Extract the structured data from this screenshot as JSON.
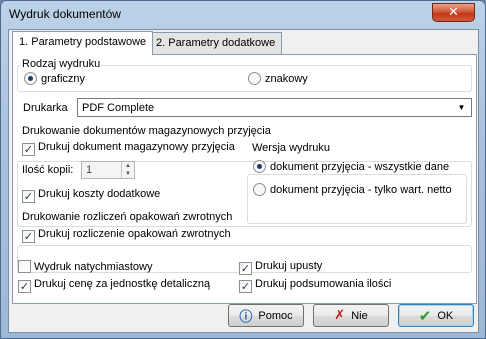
{
  "window": {
    "title": "Wydruk dokumentów",
    "close_symbol": "✕"
  },
  "tabs": [
    {
      "label": "1. Parametry podstawowe",
      "active": true
    },
    {
      "label": "2. Parametry dodatkowe",
      "active": false
    }
  ],
  "rodzaj": {
    "title": "Rodzaj wydruku",
    "options": [
      {
        "label": "graficzny",
        "selected": true
      },
      {
        "label": "znakowy",
        "selected": false
      }
    ]
  },
  "drukarka": {
    "label": "Drukarka",
    "value": "PDF Complete",
    "arrow": "▼"
  },
  "magazynowe": {
    "title": "Drukowanie dokumentów magazynowych przyjęcia",
    "drukuj_label": "Drukuj dokument magazynowy przyjęcia",
    "kopie_label": "Ilość kopii:",
    "kopie_value": "1",
    "koszty_label": "Drukuj koszty dodatkowe",
    "wersja": {
      "title": "Wersja wydruku",
      "options": [
        {
          "label": "dokument przyjęcia - wszystkie dane",
          "selected": true
        },
        {
          "label": "dokument przyjęcia - tylko wart. netto",
          "selected": false
        }
      ]
    }
  },
  "rozliczenia": {
    "title": "Drukowanie rozliczeń opakowań zwrotnych",
    "drukuj_label": "Drukuj rozliczenie opakowań zwrotnych"
  },
  "options": {
    "natychmiastowy": {
      "label": "Wydruk natychmiastowy",
      "checked": false
    },
    "cena": {
      "label": "Drukuj cenę za jednostkę detaliczną",
      "checked": true
    },
    "upusty": {
      "label": "Drukuj upusty",
      "checked": true
    },
    "podsumowania": {
      "label": "Drukuj podsumowania ilości",
      "checked": true
    }
  },
  "buttons": {
    "pomoc": "Pomoc",
    "nie": "Nie",
    "ok": "OK"
  },
  "colors": {
    "accent": "#1e3d6b",
    "ok_green": "#2e9a2e",
    "nie_red": "#c41a1a",
    "help_blue": "#2a5fb0"
  }
}
